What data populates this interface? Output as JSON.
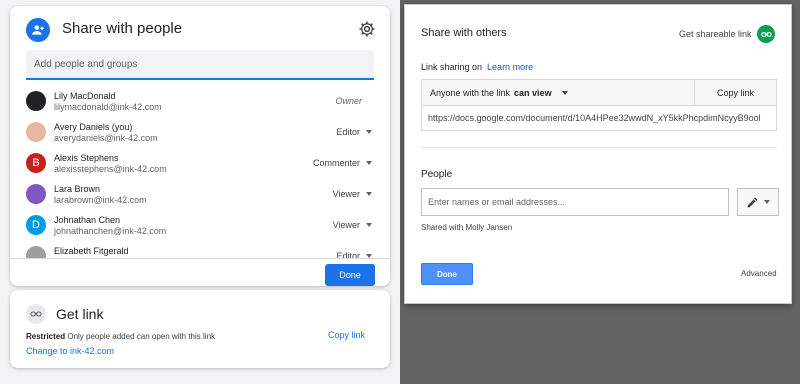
{
  "left": {
    "share": {
      "title": "Share with people",
      "search_placeholder": "Add people and groups",
      "people": [
        {
          "name": "Lily MacDonald",
          "email": "lilymacdonald@ink-42.com",
          "role": "Owner",
          "avatar": "",
          "avatar_color": "#202124"
        },
        {
          "name": "Avery Daniels (you)",
          "email": "averydaniels@ink-42.com",
          "role": "Editor",
          "avatar": "",
          "avatar_color": "#e6b8a2"
        },
        {
          "name": "Alexis Stephens",
          "email": "alexisstephens@ink-42.com",
          "role": "Commenter",
          "avatar": "B",
          "avatar_color": "#c5221f"
        },
        {
          "name": "Lara Brown",
          "email": "larabrown@ink-42.com",
          "role": "Viewer",
          "avatar": "",
          "avatar_color": "#7e57c2"
        },
        {
          "name": "Johnathan Chen",
          "email": "johnathanchen@ink-42.com",
          "role": "Viewer",
          "avatar": "D",
          "avatar_color": "#039be5"
        },
        {
          "name": "Elizabeth Fitgerald",
          "email": "",
          "role": "Editor",
          "avatar": "",
          "avatar_color": "#9e9e9e"
        }
      ],
      "done_label": "Done"
    },
    "link": {
      "title": "Get link",
      "restricted_label": "Restricted",
      "restricted_text": "Only people added can open with this link",
      "change_label": "Change to ink-42.com",
      "copy_label": "Copy link"
    }
  },
  "right": {
    "title": "Share with others",
    "get_link_label": "Get shareable link",
    "link_sharing_label": "Link sharing on",
    "learn_more": "Learn more",
    "access_prefix": "Anyone with the link",
    "access_level": "can view",
    "copy_label": "Copy link",
    "url": "https://docs.google.com/document/d/10A4HPee32wwdN_xY5kkPhcpdimNcyyB9ool",
    "people_label": "People",
    "input_placeholder": "Enter names or email addresses...",
    "shared_with": "Shared with Molly Jansen",
    "done_label": "Done",
    "advanced_label": "Advanced"
  }
}
